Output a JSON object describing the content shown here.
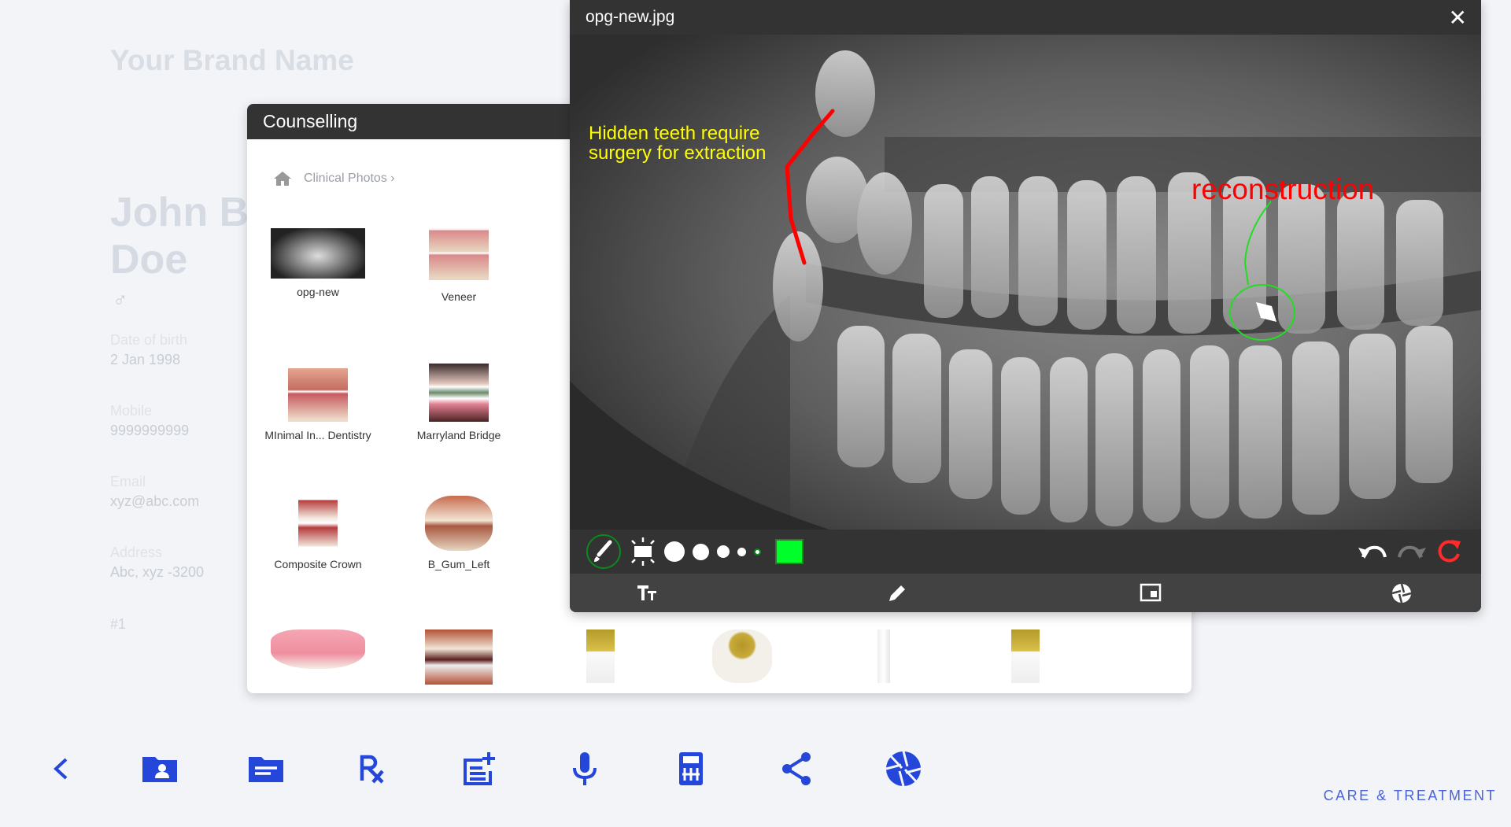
{
  "brand": "Your Brand Name",
  "patient": {
    "first": "John B",
    "last": "Doe",
    "gender_symbol": "♂",
    "fields": [
      {
        "label": "Date of birth",
        "value": "2 Jan 1998"
      },
      {
        "label": "Mobile",
        "value": "9999999999"
      },
      {
        "label": "Email",
        "value": "xyz@abc.com"
      },
      {
        "label": "Address",
        "value": "Abc, xyz -3200"
      }
    ],
    "index": "#1"
  },
  "counselling": {
    "title": "Counselling",
    "breadcrumb": "Clinical Photos ›",
    "items": [
      {
        "label": "opg-new"
      },
      {
        "label": "Veneer"
      },
      {
        "label": "MInimal In... Dentistry"
      },
      {
        "label": "Marryland Bridge"
      },
      {
        "label": "Composite Crown"
      },
      {
        "label": "B_Gum_Left"
      }
    ]
  },
  "viewer": {
    "title": "opg-new.jpg",
    "close": "✕",
    "annotations": {
      "yellow": "Hidden teeth require",
      "yellow2": "surgery for extraction",
      "red": "reconstruction"
    },
    "colors": {
      "selected": "#00ff2a",
      "red_annot": "#ff0000",
      "yellow_annot": "#ffff00",
      "green_annot": "#22dd22"
    }
  },
  "footer": {
    "label": "CARE & TREATMENT",
    "accent": "#2547d9"
  }
}
